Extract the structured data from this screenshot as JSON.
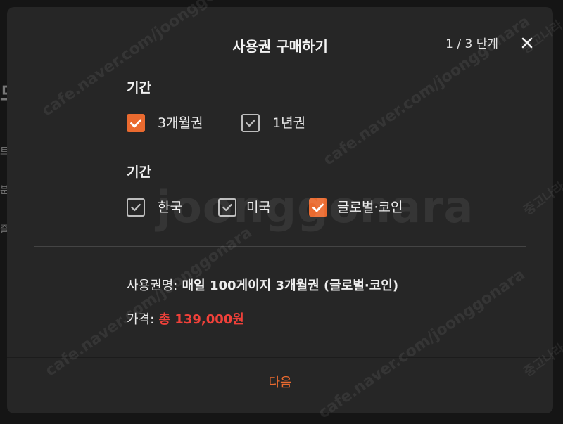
{
  "modal": {
    "title": "사용권 구매하기",
    "step": "1 / 3 단계",
    "close_symbol": "✕"
  },
  "period_section": {
    "label": "기간",
    "options": [
      {
        "label": "3개월권",
        "checked": true
      },
      {
        "label": "1년권",
        "checked": false
      }
    ]
  },
  "region_section": {
    "label": "기간",
    "options": [
      {
        "label": "한국",
        "checked": false
      },
      {
        "label": "미국",
        "checked": false
      },
      {
        "label": "글로벌·코인",
        "checked": true
      }
    ]
  },
  "summary": {
    "name_label": "사용권명:",
    "name_value": "매일 100게이지 3개월권 (글로벌·코인)",
    "price_label": "가격:",
    "price_value": "총 139,000원"
  },
  "footer": {
    "next_label": "다음"
  },
  "background_fragments": [
    "드",
    "트",
    "분",
    "즐"
  ],
  "watermarks": {
    "brand": "joonggonara",
    "site": "cafe.naver.com/joonggonara",
    "tag": "중고나라"
  },
  "colors": {
    "accent": "#ea6a2f",
    "price": "#f0413a",
    "modal_bg": "#262626"
  }
}
